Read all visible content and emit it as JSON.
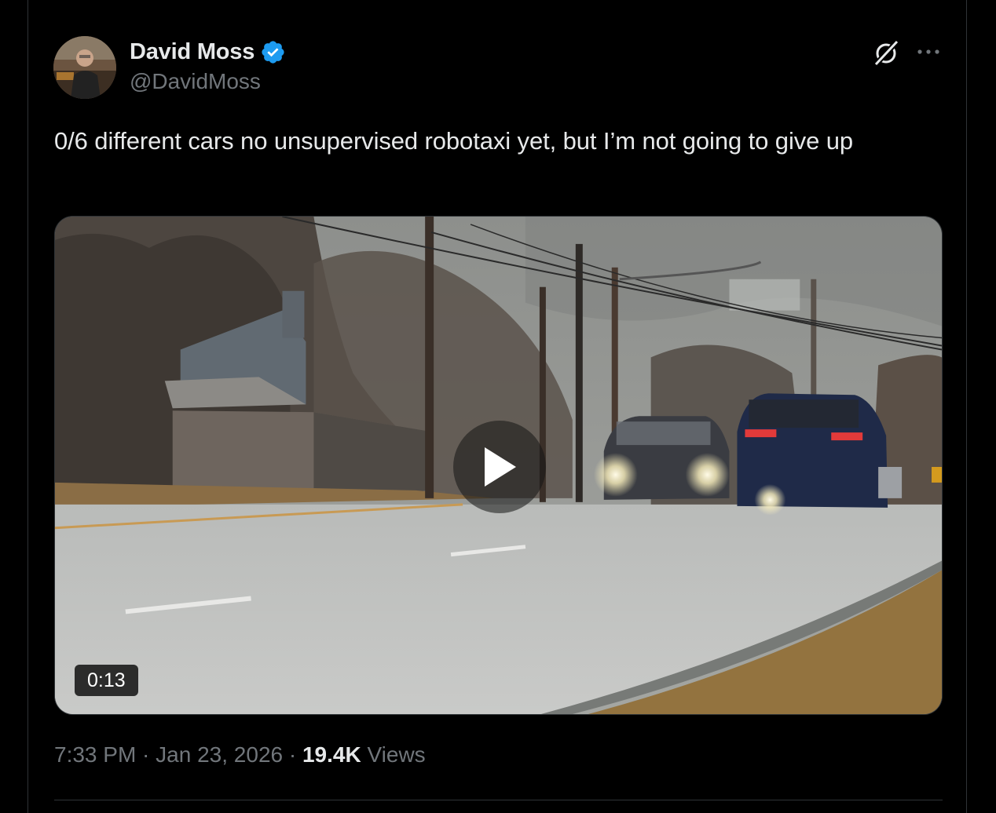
{
  "author": {
    "display_name": "David Moss",
    "handle": "@DavidMoss",
    "verified": true,
    "verified_color": "#1d9bf0",
    "avatar_icon": "avatar-photo"
  },
  "header_icons": [
    "grok-icon",
    "more-options-icon"
  ],
  "tweet": {
    "text": "0/6 different cars no unsupervised robotaxi yet, but I’m not going to give up"
  },
  "media": {
    "type": "video",
    "duration": "0:13",
    "play_icon": "play-icon"
  },
  "meta": {
    "time": "7:33 PM",
    "separator1": " · ",
    "date": "Jan 23, 2026",
    "separator2": " · ",
    "views_count": "19.4K",
    "views_label": " Views"
  }
}
